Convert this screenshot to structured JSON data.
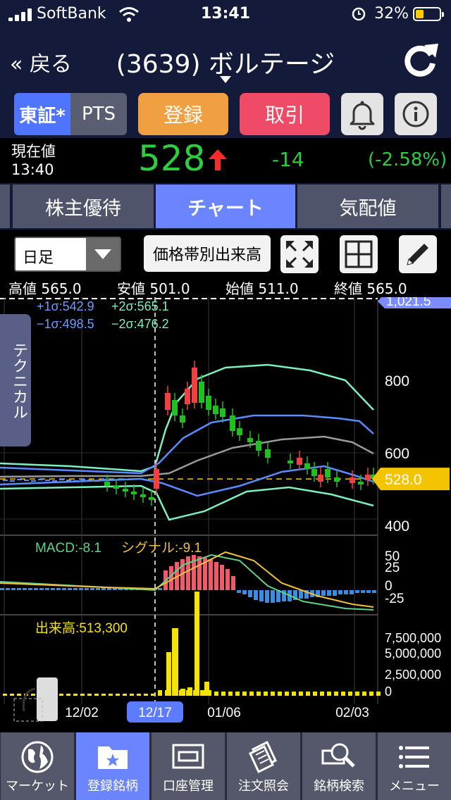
{
  "status": {
    "carrier": "SoftBank",
    "time": "13:41",
    "battery": "32%"
  },
  "nav": {
    "back": "« 戻る",
    "title": "(3639) ボルテージ"
  },
  "buttons": {
    "tosho": "東証*",
    "pts": "PTS",
    "register": "登録",
    "trade": "取引"
  },
  "quote": {
    "label": "現在値",
    "time": "13:40",
    "price": "528",
    "change": "-14",
    "change_pct": "(-2.58%)",
    "color_down": "#2ecc40",
    "arrow_color": "#ff2a2a"
  },
  "tabs": [
    "株主優待",
    "チャート",
    "気配値"
  ],
  "toolbar": {
    "period": "日足",
    "volume_profile": "価格帯別出来高"
  },
  "ohlc": {
    "high": "高値 565.0",
    "low": "安値 501.0",
    "open": "始値 511.0",
    "close": "終値 565.0"
  },
  "sidebar": {
    "technical": "テクニカル"
  },
  "chart_labels": {
    "bb1": "+1σ:542.9",
    "bb2": "+2σ:565.1",
    "bbm1": "−1σ:498.5",
    "bbm2": "−2σ:476.2",
    "macd": "MACD:-8.1",
    "signal": "シグナル:-9.1",
    "volume": "出来高:513,300",
    "price_tag": "528.0",
    "top_tag": "1,021.5"
  },
  "chart_data": {
    "type": "candlestick",
    "price_axis_ticks": [
      "800",
      "600",
      "400"
    ],
    "macd_axis_ticks": [
      "50",
      "25",
      "0",
      "-25"
    ],
    "volume_axis_ticks": [
      "7,500,000",
      "5,000,000",
      "2,500,000",
      "0"
    ],
    "x_ticks": [
      "12/02",
      "12/17",
      "01/06",
      "02/03"
    ],
    "highlighted_x": "12/17",
    "current_price": 528.0,
    "ylim": [
      330,
      1021.5
    ]
  },
  "bottom_nav": [
    "マーケット",
    "登録銘柄",
    "口座管理",
    "注文照会",
    "銘柄検索",
    "メニュー"
  ],
  "active_nav": 1
}
